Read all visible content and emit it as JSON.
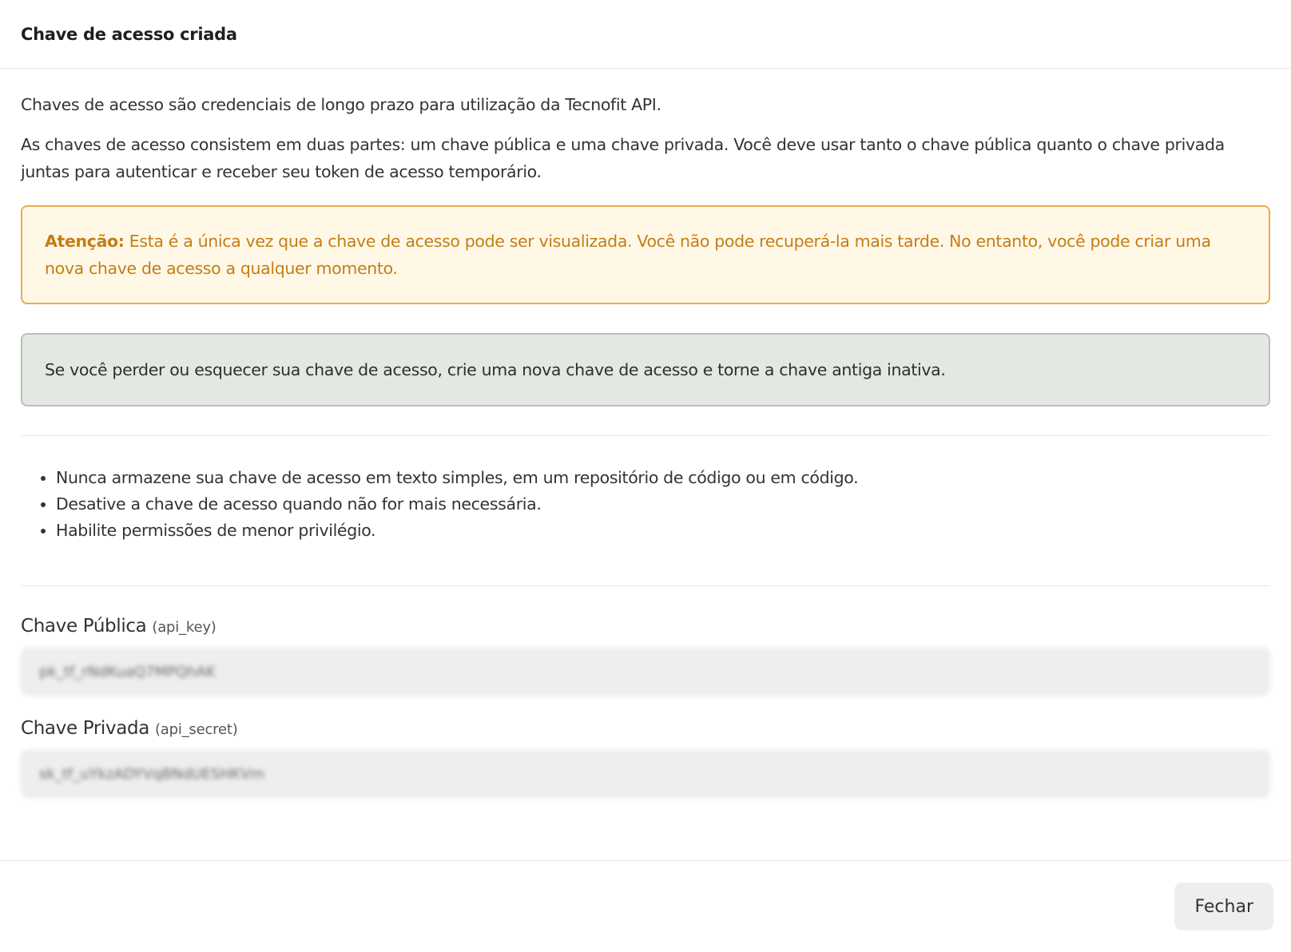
{
  "modal": {
    "title": "Chave de acesso criada"
  },
  "intro": {
    "line1": "Chaves de acesso são credenciais de longo prazo para utilização da Tecnofit API.",
    "line2": "As chaves de acesso consistem em duas partes: um chave pública e uma chave privada. Você deve usar tanto o chave pública quanto o chave privada juntas para autenticar e receber seu token de acesso temporário."
  },
  "warning": {
    "label": "Atenção:",
    "text": " Esta é a única vez que a chave de acesso pode ser visualizada. Você não pode recuperá-la mais tarde. No entanto, você pode criar uma nova chave de acesso a qualquer momento."
  },
  "info": {
    "text": "Se você perder ou esquecer sua chave de acesso, crie uma nova chave de acesso e torne a chave antiga inativa."
  },
  "tips": [
    "Nunca armazene sua chave de acesso em texto simples, em um repositório de código ou em código.",
    "Desative a chave de acesso quando não for mais necessária.",
    "Habilite permissões de menor privilégio."
  ],
  "fields": {
    "public": {
      "label": "Chave Pública",
      "hint": "(api_key)",
      "value": "pk_tf_rNdKuaQ7MPQhAK"
    },
    "private": {
      "label": "Chave Privada",
      "hint": "(api_secret)",
      "value": "sk_tf_uYkzADYVqBNdUESHKVm"
    }
  },
  "footer": {
    "close_label": "Fechar"
  }
}
